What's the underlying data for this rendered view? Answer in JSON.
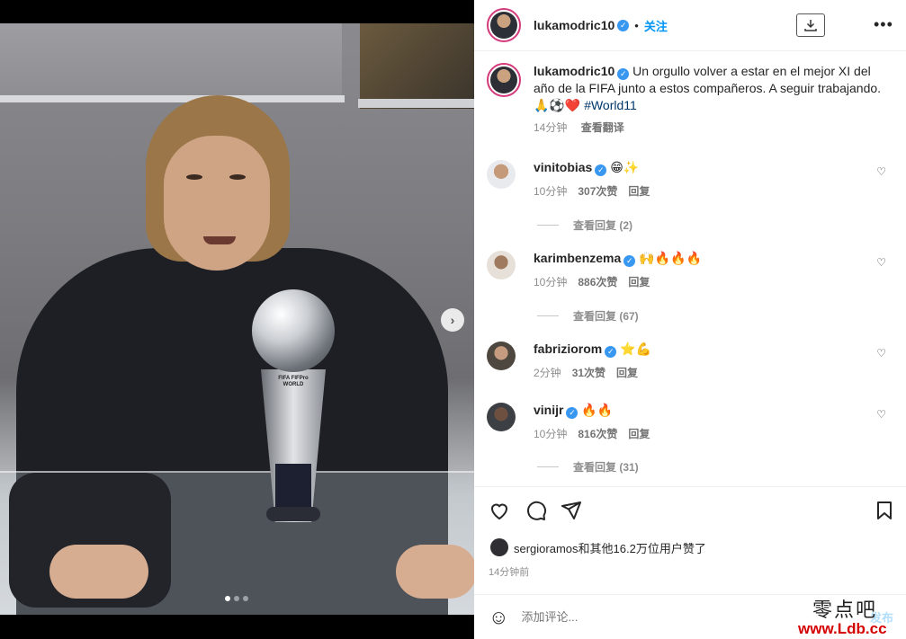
{
  "post": {
    "author": "lukamodric10",
    "follow_label": "关注",
    "caption_text": "Un orgullo volver a estar en el mejor XI del año de la FIFA junto a estos compañeros. A seguir trabajando.",
    "caption_emojis": "🙏⚽❤️",
    "hashtag": "#World11",
    "caption_time": "14分钟",
    "translate_label": "查看翻译",
    "trophy_text": "FIFA FIFPro WORLD",
    "carousel_count": 3,
    "carousel_index": 0
  },
  "comments": [
    {
      "user": "vinitobias",
      "text": "😁✨",
      "time": "10分钟",
      "likes": "307次赞",
      "reply": "回复",
      "replies": "查看回复 (2)"
    },
    {
      "user": "karimbenzema",
      "text": "🙌🔥🔥🔥",
      "time": "10分钟",
      "likes": "886次赞",
      "reply": "回复",
      "replies": "查看回复 (67)"
    },
    {
      "user": "fabriziorom",
      "text": "⭐💪",
      "time": "2分钟",
      "likes": "31次赞",
      "reply": "回复"
    },
    {
      "user": "vinijr",
      "text": "🔥🔥",
      "time": "10分钟",
      "likes": "816次赞",
      "reply": "回复",
      "replies": "查看回复 (31)"
    }
  ],
  "footer": {
    "liked_by": "sergioramos和其他16.2万位用户赞了",
    "timestamp": "14分钟前",
    "comment_placeholder": "添加评论...",
    "post_label": "发布"
  },
  "watermark": {
    "line1": "零点吧",
    "line2": "www.Ldb.cc"
  },
  "colors": {
    "accent": "#0095f6",
    "verified": "#3897f0",
    "story_ring": "#d43a7a"
  }
}
